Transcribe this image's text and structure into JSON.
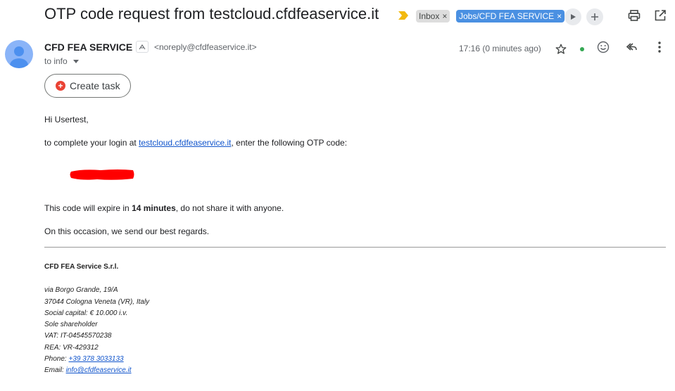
{
  "header": {
    "subject": "OTP code request from testcloud.cfdfeaservice.it",
    "labels": [
      {
        "text": "Inbox",
        "close": "×"
      },
      {
        "text": "Jobs/CFD FEA SERVICE",
        "close": "×"
      }
    ],
    "icons": [
      "importance-marker-icon",
      "play-icon",
      "plus-icon",
      "print-icon",
      "open-new-window-icon"
    ]
  },
  "message": {
    "sender_name": "CFD FEA SERVICE",
    "sender_email": "<noreply@cfdfeaservice.it>",
    "to": "to info",
    "time": "17:16 (0 minutes ago)",
    "create_task": "Create task"
  },
  "body": {
    "greeting": "Hi Usertest,",
    "line1_pre": "to complete your login at ",
    "line1_link": "testcloud.cfdfeaservice.it",
    "line1_post": ", enter the following OTP code:",
    "expire_pre": "This code will expire in ",
    "expire_bold": "14 minutes",
    "expire_post": ", do not share it with anyone.",
    "regards": "On this occasion, we send our best regards."
  },
  "signature": {
    "company": "CFD FEA Service S.r.l.",
    "address1": "via Borgo Grande, 19/A",
    "address2": "37044 Cologna Veneta (VR), Italy",
    "capital": "Social capital: € 10.000 i.v.",
    "shareholder": "Sole shareholder",
    "vat": "VAT: IT-04545570238",
    "rea": "REA: VR-429312",
    "phone_label": "Phone: ",
    "phone": "+39 378 3033133",
    "email_label": "Email: ",
    "email": "info@cfdfeaservice.it"
  },
  "colors": {
    "link": "#1155cc",
    "label_jobs": "#4a90e2",
    "redaction": "#ff0000",
    "importance": "#f2b90f"
  }
}
